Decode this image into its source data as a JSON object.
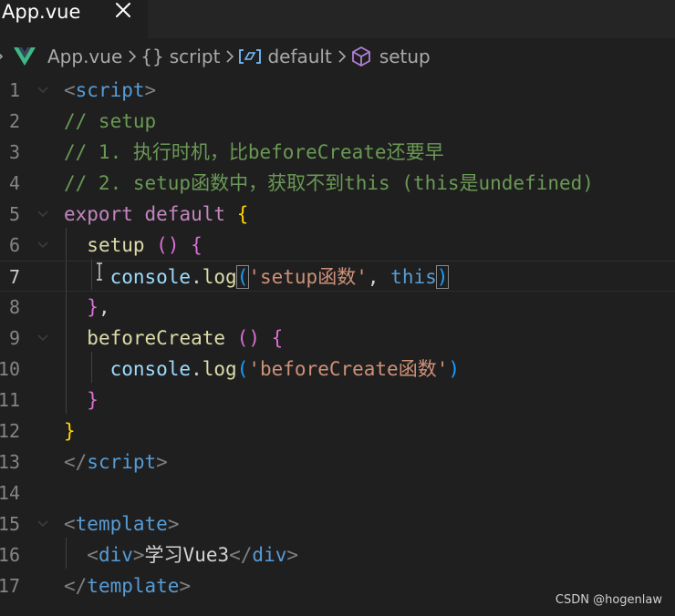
{
  "tab": {
    "title": "App.vue",
    "close_icon": "close-icon"
  },
  "breadcrumb": {
    "items": [
      {
        "label": "App.vue",
        "icon": "vue-logo-icon"
      },
      {
        "label": "script",
        "icon": "braces-icon"
      },
      {
        "label": "default",
        "icon": "variable-symbol-icon"
      },
      {
        "label": "setup",
        "icon": "cube-method-icon"
      }
    ]
  },
  "editor": {
    "line_numbers": [
      "1",
      "2",
      "3",
      "4",
      "5",
      "6",
      "7",
      "8",
      "9",
      "10",
      "11",
      "12",
      "13",
      "14",
      "15",
      "16",
      "17"
    ],
    "active_line": "7",
    "tokens": {
      "lt": "<",
      "gt": ">",
      "lts": "</",
      "script": "script",
      "template": "template",
      "div": "div",
      "c1": "// setup",
      "c2": "// 1. 执行时机，比beforeCreate还要早",
      "c3": "// 2. setup函数中，获取不到this (this是undefined)",
      "export": "export",
      "default": "default",
      "lbrace": "{",
      "rbrace": "}",
      "setup": "setup",
      "paren_open": "(",
      "paren_close": ")",
      "empty_parens": "()",
      "console": "console",
      "dot": ".",
      "log": "log",
      "str_setup": "'setup函数'",
      "comma": ",",
      "this": "this",
      "brace_comma": "},",
      "beforeCreate": "beforeCreate",
      "str_before": "'beforeCreate函数'",
      "div_text": "学习Vue3"
    }
  },
  "watermark": "CSDN @hogenlaw",
  "colors": {
    "background": "#1f1f1f",
    "tag": "#569cd6",
    "comment": "#6a9955",
    "keyword": "#c586c0",
    "function": "#dcdcaa",
    "variable": "#9cdcfe",
    "string": "#ce9178",
    "bracket1": "#ffd700",
    "bracket2": "#da70d6",
    "bracket3": "#179fff",
    "vue_green": "#41b883"
  }
}
